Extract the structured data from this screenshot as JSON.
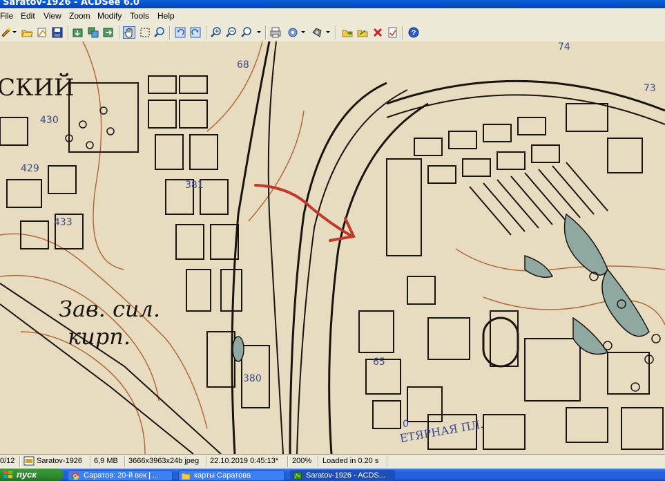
{
  "window": {
    "title": "Saratov-1926 - ACDSee 6.0"
  },
  "menu": {
    "items": [
      "File",
      "Edit",
      "View",
      "Zoom",
      "Modify",
      "Tools",
      "Help"
    ]
  },
  "toolbar": {
    "icons": [
      "wizard-icon",
      "open-folder-icon",
      "browse-icon",
      "save-icon",
      "acquire-icon",
      "copy-to-icon",
      "move-to-icon",
      "hand-tool-icon",
      "select-tool-icon",
      "zoom-tool-icon",
      "rotate-left-icon",
      "rotate-right-icon",
      "zoom-in-icon",
      "zoom-out-icon",
      "zoom-mode-icon",
      "print-icon",
      "share-icon",
      "convert-icon",
      "previous-image-icon",
      "next-image-icon",
      "delete-icon",
      "properties-icon",
      "help-icon"
    ]
  },
  "map": {
    "labels": {
      "left_fragment": "СКИЙ",
      "factory_line1": "Зав. сил.",
      "factory_line2": "кирп.",
      "square": "ЕТЯРНАЯ ПЛ.",
      "n74": "74",
      "n73": "73",
      "n68": "68",
      "n430": "430",
      "n429": "429",
      "n381": "381",
      "n433": "433",
      "n380": "380",
      "n65": "65",
      "n0": "0"
    },
    "colors": {
      "paper": "#e8dcc0",
      "ink": "#1a1410",
      "contour": "#b06a3a",
      "water": "#8fa8a0",
      "arrow": "#c0392b",
      "numbers": "#3a4a8a"
    }
  },
  "status": {
    "index": "0/12",
    "filename": "Saratov-1926",
    "filesize": "6,9 MB",
    "dimensions": "3666x3963x24b jpeg",
    "datetime": "22.10.2019 0:45:13*",
    "zoom": "200%",
    "load_time": "Loaded in 0.20 s"
  },
  "taskbar": {
    "start_label": "пуск",
    "tasks": [
      {
        "label": "Саратов: 20-й век | ...",
        "icon": "chrome-icon"
      },
      {
        "label": "карты Саратова",
        "icon": "folder-icon"
      },
      {
        "label": "Saratov-1926 - ACDS...",
        "icon": "acdsee-icon"
      }
    ]
  }
}
